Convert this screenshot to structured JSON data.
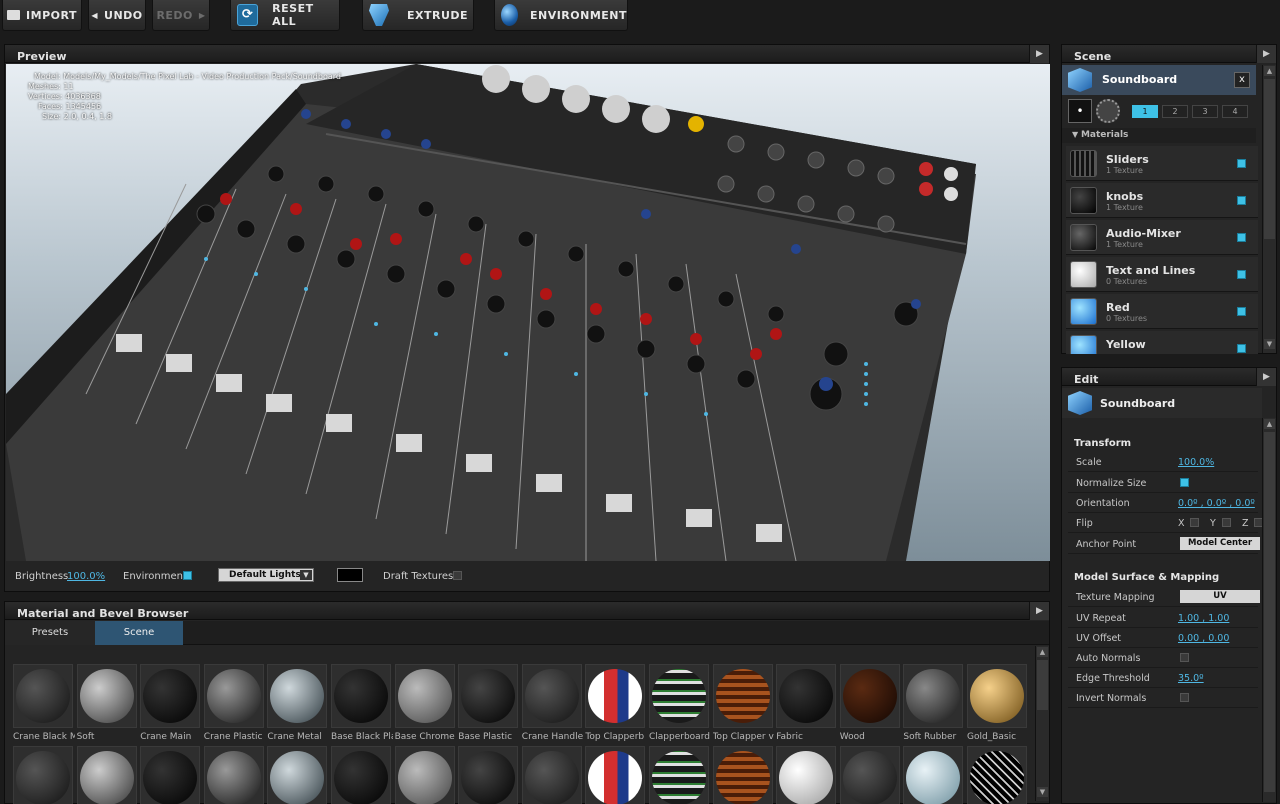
{
  "toolbar": {
    "import": "IMPORT",
    "undo": "UNDO",
    "redo": "REDO",
    "reset_all": "RESET ALL",
    "extrude": "EXTRUDE",
    "environment": "ENVIRONMENT"
  },
  "preview": {
    "title": "Preview",
    "overlay": [
      "Model: Models/My_Models/The Pixel Lab - Video Production Pack/Soundboard",
      "Meshes: 11",
      "Vertices: 4036368",
      "Faces: 1345456",
      "Size: 2.0, 0.4, 1.8"
    ],
    "brightness_label": "Brightness",
    "brightness_value": "100.0%",
    "environment_label": "Environment",
    "lights_select": "Default Lights",
    "draft_label": "Draft Textures"
  },
  "browser": {
    "title": "Material and Bevel Browser",
    "tabs": [
      "Presets",
      "Scene"
    ],
    "row1": [
      "Crane Black M",
      "Soft",
      "Crane Main",
      "Crane Plastic",
      "Crane Metal",
      "Base Black Pla",
      "Base Chrome",
      "Base Plastic",
      "Crane Handle",
      "Top Clapperb",
      "Clapperboard",
      "Top Clapper v",
      "Fabric",
      "Wood",
      "Soft Rubber",
      "Gold_Basic"
    ]
  },
  "scene": {
    "title": "Scene",
    "object": "Soundboard",
    "close": "x",
    "pages": [
      "1",
      "2",
      "3",
      "4"
    ],
    "materials_header": "Materials",
    "materials": [
      {
        "name": "Sliders",
        "sub": "1 Texture"
      },
      {
        "name": "knobs",
        "sub": "1 Texture"
      },
      {
        "name": "Audio-Mixer",
        "sub": "1 Texture"
      },
      {
        "name": "Text and Lines",
        "sub": "0 Textures"
      },
      {
        "name": "Red",
        "sub": "0 Textures"
      },
      {
        "name": "Yellow",
        "sub": ""
      }
    ]
  },
  "edit": {
    "title": "Edit",
    "object": "Soundboard",
    "transform_header": "Transform",
    "scale_label": "Scale",
    "scale_value": "100.0%",
    "normalize_label": "Normalize Size",
    "orientation_label": "Orientation",
    "orientation_value": "0.0º , 0.0º , 0.0º",
    "flip_label": "Flip",
    "flip_x": "X",
    "flip_y": "Y",
    "flip_z": "Z",
    "anchor_label": "Anchor Point",
    "anchor_value": "Model Center",
    "surface_header": "Model Surface & Mapping",
    "texmap_label": "Texture Mapping",
    "texmap_value": "UV",
    "uvrepeat_label": "UV Repeat",
    "uvrepeat_value": "1.00 , 1.00",
    "uvoffset_label": "UV Offset",
    "uvoffset_value": "0.00 , 0.00",
    "autonormals_label": "Auto Normals",
    "edge_label": "Edge Threshold",
    "edge_value": "35.0º",
    "invert_label": "Invert Normals"
  }
}
